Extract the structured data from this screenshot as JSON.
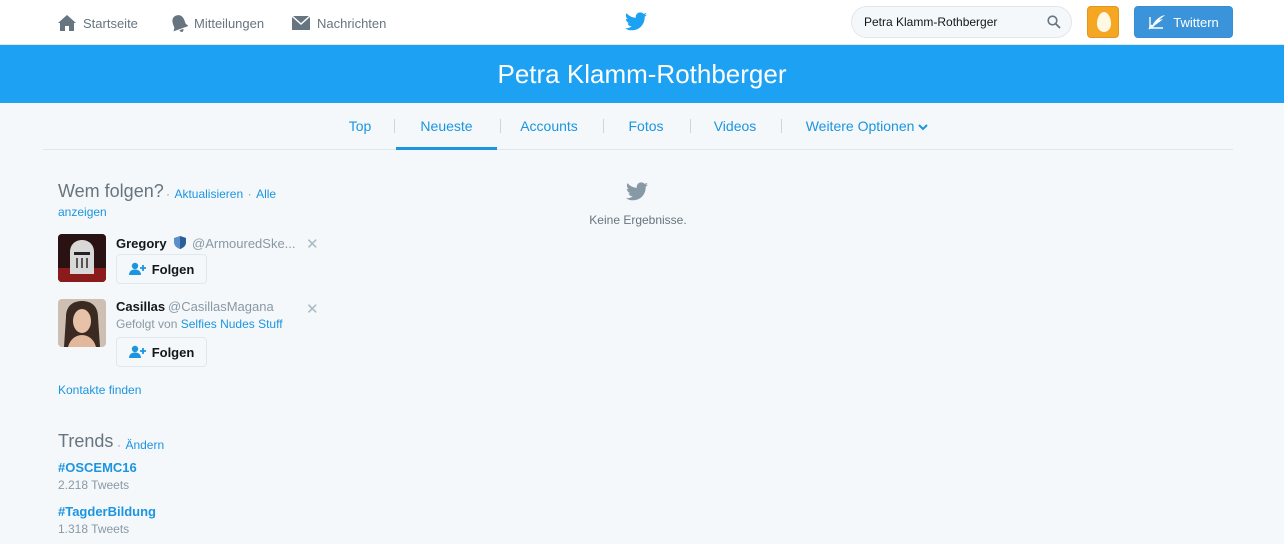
{
  "nav": {
    "home": "Startseite",
    "notifications": "Mitteilungen",
    "messages": "Nachrichten"
  },
  "search": {
    "value": "Petra Klamm-Rothberger"
  },
  "tweet_button": "Twittern",
  "header": {
    "title": "Petra Klamm-Rothberger"
  },
  "tabs": [
    {
      "label": "Top"
    },
    {
      "label": "Neueste",
      "active": true
    },
    {
      "label": "Accounts"
    },
    {
      "label": "Fotos"
    },
    {
      "label": "Videos"
    },
    {
      "label": "Weitere Optionen"
    }
  ],
  "who_to_follow": {
    "title": "Wem folgen?",
    "refresh": "Aktualisieren",
    "view_all_1": "Alle",
    "view_all_2": "anzeigen",
    "separator": "·",
    "users": [
      {
        "name": "Gregory",
        "handle": "@ArmouredSke...",
        "follow_label": "Folgen"
      },
      {
        "name": "Casillas",
        "handle": "@CasillasMagana",
        "followed_by_prefix": "Gefolgt von",
        "followed_by": "Selfies Nudes Stuff",
        "follow_label": "Folgen"
      }
    ],
    "find_contacts": "Kontakte finden"
  },
  "trends": {
    "title": "Trends",
    "change": "Ändern",
    "items": [
      {
        "name": "#OSCEMC16",
        "count": "2.218 Tweets"
      },
      {
        "name": "#TagderBildung",
        "count": "1.318 Tweets"
      }
    ]
  },
  "results": {
    "empty_text": "Keine Ergebnisse."
  },
  "colors": {
    "brand": "#1da1f2",
    "link": "#1b95e0",
    "tweet_button": "#3b94d9",
    "avatar_bg": "#f5a623"
  }
}
